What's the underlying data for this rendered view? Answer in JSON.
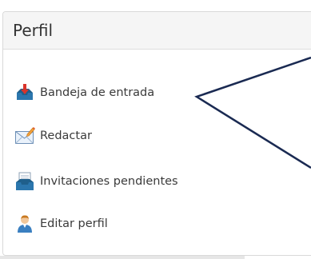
{
  "panel": {
    "title": "Perfil"
  },
  "menu": {
    "items": [
      {
        "label": "Bandeja de entrada",
        "icon": "inbox-icon"
      },
      {
        "label": "Redactar",
        "icon": "compose-envelope-icon"
      },
      {
        "label": "Invitaciones pendientes",
        "icon": "pending-invitations-icon"
      },
      {
        "label": "Editar perfil",
        "icon": "user-profile-icon"
      }
    ]
  },
  "colors": {
    "heading_bg": "#f5f5f5",
    "border": "#dddddd",
    "text": "#333333",
    "inbox_red": "#d9342b",
    "inbox_blue": "#1f5f8b",
    "arrow_stroke": "#1a2a52"
  }
}
